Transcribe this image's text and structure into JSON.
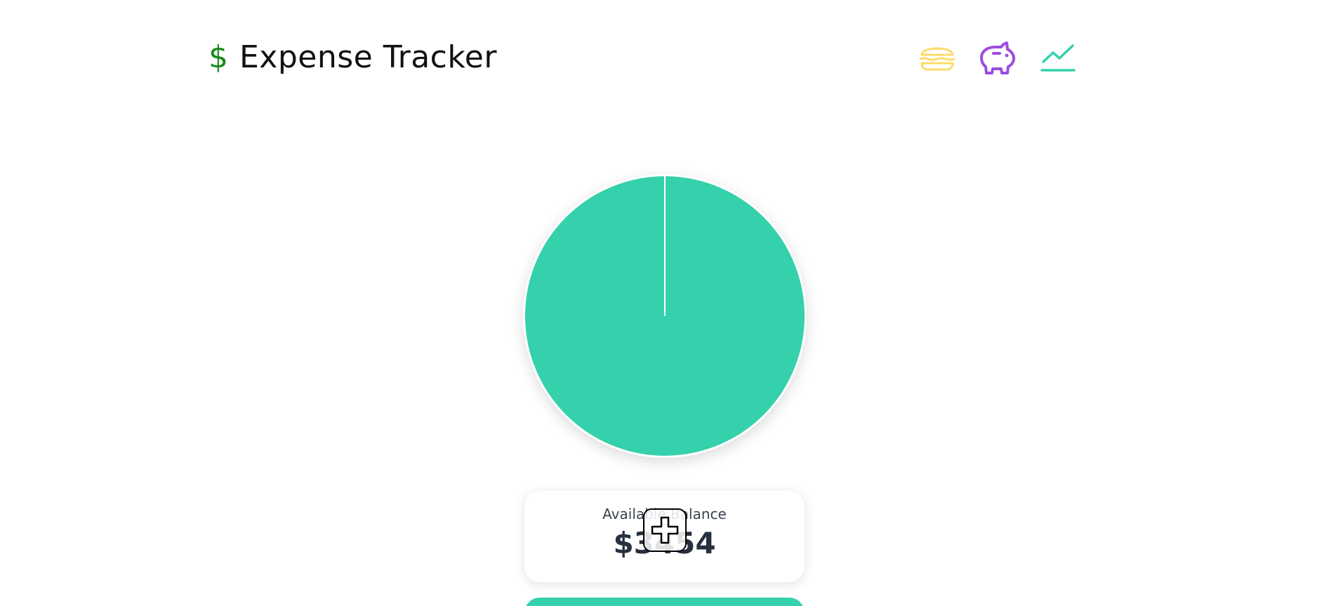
{
  "app": {
    "logo_symbol": "$",
    "title": "Expense Tracker"
  },
  "nav": {
    "items": [
      {
        "icon": "burger-icon",
        "color": "#fbdc6a"
      },
      {
        "icon": "piggy-bank-icon",
        "color": "#9b4de0"
      },
      {
        "icon": "trend-chart-icon",
        "color": "#34d1ac"
      }
    ]
  },
  "chart_data": {
    "type": "pie",
    "values": [
      100
    ],
    "colors": [
      "#34d1ac"
    ]
  },
  "balance": {
    "label": "Available Balance",
    "value": "$3454"
  },
  "colors": {
    "accent": "#34d1ac",
    "logo": "#1a8a1a",
    "text_dark": "#26303f"
  }
}
